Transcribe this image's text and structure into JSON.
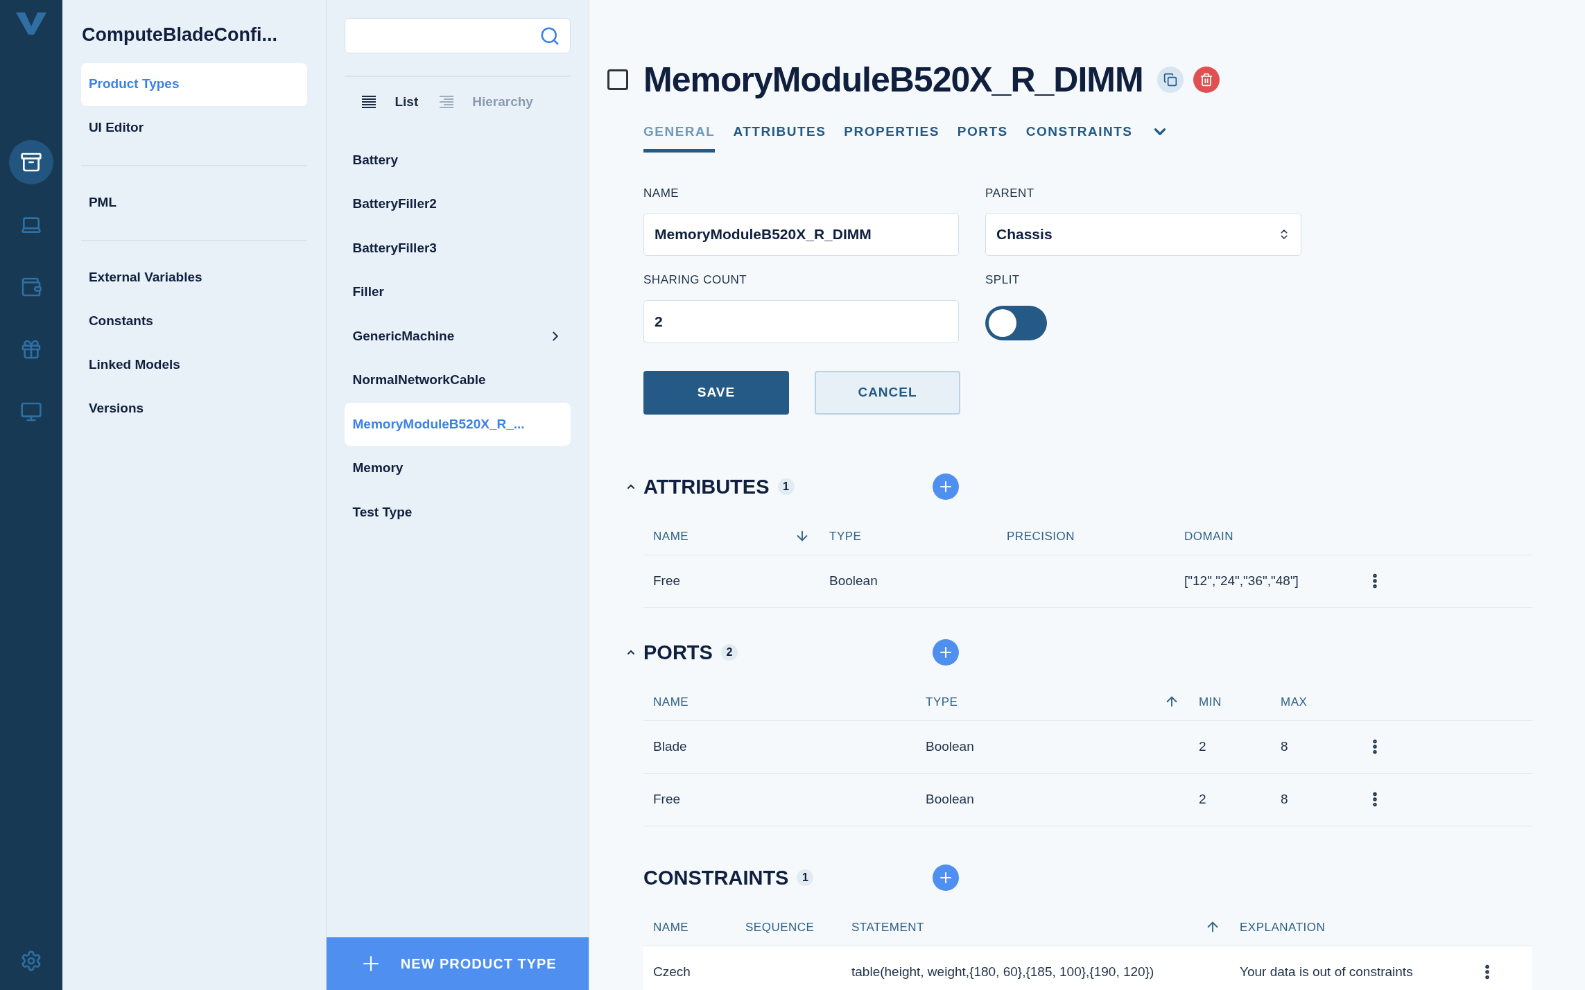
{
  "nav": {
    "title": "ComputeBladeConfi...",
    "groups": [
      [
        {
          "label": "Product Types",
          "selected": true
        },
        {
          "label": "UI Editor",
          "selected": false
        }
      ],
      [
        {
          "label": "PML",
          "selected": false
        }
      ],
      [
        {
          "label": "External Variables",
          "selected": false
        },
        {
          "label": "Constants",
          "selected": false
        },
        {
          "label": "Linked Models",
          "selected": false
        },
        {
          "label": "Versions",
          "selected": false
        }
      ]
    ]
  },
  "rail": {
    "items": [
      {
        "kind": "box",
        "selected": true
      },
      {
        "kind": "laptop",
        "selected": false
      },
      {
        "kind": "wallet",
        "selected": false
      },
      {
        "kind": "gift",
        "selected": false
      },
      {
        "kind": "monitor",
        "selected": false
      }
    ]
  },
  "list": {
    "views": [
      {
        "label": "List",
        "kind": "list",
        "selected": true
      },
      {
        "label": "Hierarchy",
        "kind": "hierarchy",
        "selected": false
      }
    ],
    "items": [
      {
        "label": "Battery",
        "selected": false,
        "has_children": false
      },
      {
        "label": "BatteryFiller2",
        "selected": false,
        "has_children": false
      },
      {
        "label": "BatteryFiller3",
        "selected": false,
        "has_children": false
      },
      {
        "label": "Filler",
        "selected": false,
        "has_children": false
      },
      {
        "label": "GenericMachine",
        "selected": false,
        "has_children": true
      },
      {
        "label": "NormalNetworkCable",
        "selected": false,
        "has_children": false
      },
      {
        "label": "MemoryModuleB520X_R_...",
        "selected": true,
        "has_children": false
      },
      {
        "label": "Memory",
        "selected": false,
        "has_children": false
      },
      {
        "label": "Test Type",
        "selected": false,
        "has_children": false
      }
    ],
    "new_button": "NEW PRODUCT TYPE"
  },
  "detail": {
    "title": "MemoryModuleB520X_R_DIMM",
    "checked": false,
    "tabs": [
      {
        "label": "GENERAL",
        "selected": true
      },
      {
        "label": "ATTRIBUTES",
        "selected": false
      },
      {
        "label": "PROPERTIES",
        "selected": false
      },
      {
        "label": "PORTS",
        "selected": false
      },
      {
        "label": "CONSTRAINTS",
        "selected": false
      }
    ],
    "form": {
      "name_label": "NAME",
      "name_value": "MemoryModuleB520X_R_DIMM",
      "parent_label": "PARENT",
      "parent_value": "Chassis",
      "sharing_label": "SHARING COUNT",
      "sharing_value": "2",
      "split_label": "SPLIT",
      "split_on": false,
      "save": "SAVE",
      "cancel": "CANCEL"
    },
    "sections": [
      {
        "title": "ATTRIBUTES",
        "count": "1",
        "kind": "collapsible",
        "expanded": true,
        "columns": [
          {
            "label": "NAME",
            "kind": "sort-desc"
          },
          {
            "label": "TYPE",
            "kind": "plain"
          },
          {
            "label": "PRECISION",
            "kind": "plain"
          },
          {
            "label": "DOMAIN",
            "kind": "plain"
          }
        ],
        "rows": [
          {
            "cells": [
              "Free",
              "Boolean",
              "",
              "[\"12\",\"24\",\"36\",\"48\"]"
            ]
          }
        ]
      },
      {
        "title": "PORTS",
        "count": "2",
        "kind": "collapsible",
        "expanded": true,
        "columns": [
          {
            "label": "NAME",
            "kind": "plain"
          },
          {
            "label": "TYPE",
            "kind": "sort-asc"
          },
          {
            "label": "MIN",
            "kind": "plain"
          },
          {
            "label": "MAX",
            "kind": "plain"
          }
        ],
        "rows": [
          {
            "cells": [
              "Blade",
              "Boolean",
              "2",
              "8"
            ]
          },
          {
            "cells": [
              "Free",
              "Boolean",
              "2",
              "8"
            ]
          }
        ]
      },
      {
        "title": "CONSTRAINTS",
        "count": "1",
        "kind": "static",
        "columns": [
          {
            "label": "NAME",
            "kind": "plain"
          },
          {
            "label": "SEQUENCE",
            "kind": "plain"
          },
          {
            "label": "STATEMENT",
            "kind": "sort-asc"
          },
          {
            "label": "EXPLANATION",
            "kind": "plain"
          }
        ],
        "rows": [
          {
            "cells": [
              "Czech",
              "",
              "table(height, weight,{180, 60},{185, 100},{190, 120})",
              "Your data is out of constraints"
            ]
          }
        ]
      }
    ]
  }
}
